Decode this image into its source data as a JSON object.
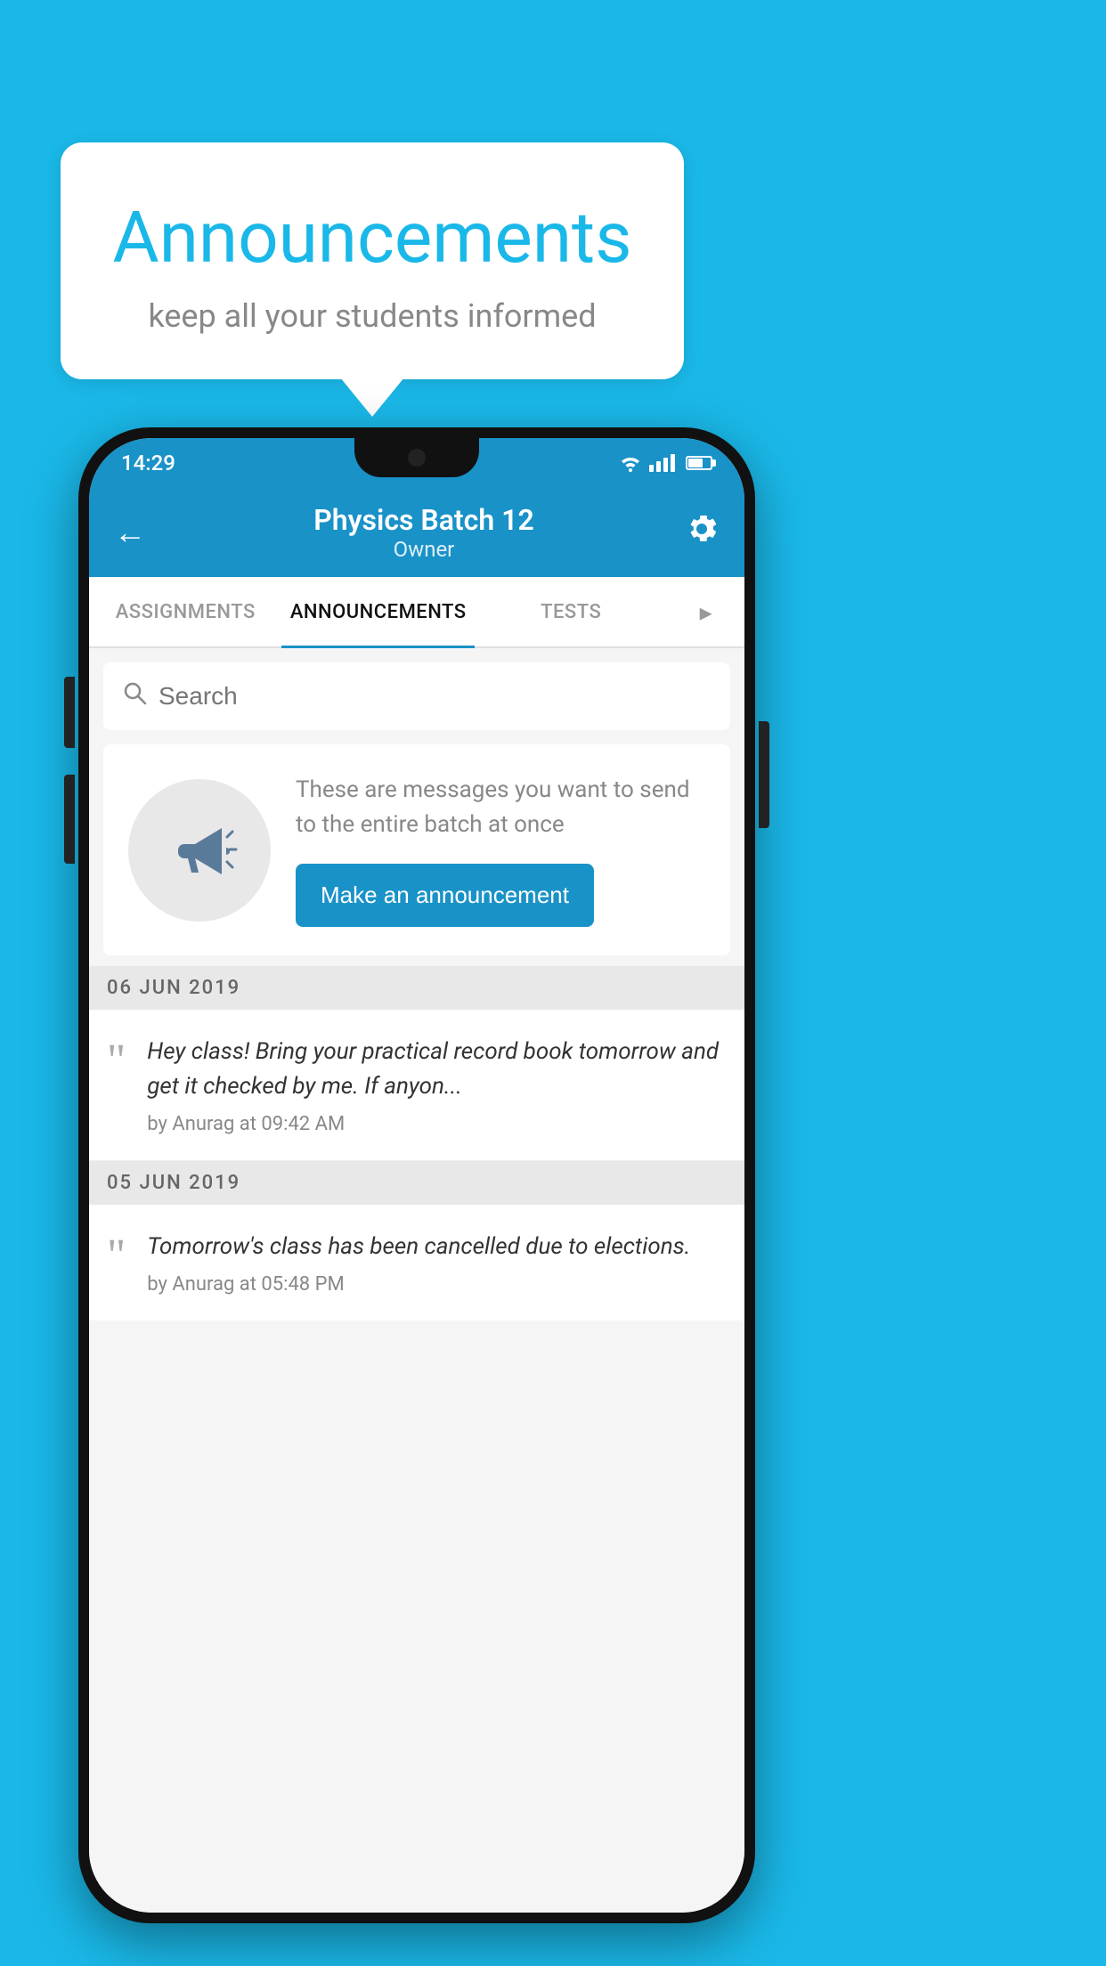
{
  "background_color": "#1ab8e8",
  "speech_bubble": {
    "title": "Announcements",
    "subtitle": "keep all your students informed"
  },
  "status_bar": {
    "time": "14:29",
    "wifi": true,
    "signal": true,
    "battery": true
  },
  "app_bar": {
    "title": "Physics Batch 12",
    "subtitle": "Owner",
    "back_label": "←",
    "gear_label": "⚙"
  },
  "tabs": [
    {
      "label": "ASSIGNMENTS",
      "active": false
    },
    {
      "label": "ANNOUNCEMENTS",
      "active": true
    },
    {
      "label": "TESTS",
      "active": false
    }
  ],
  "search": {
    "placeholder": "Search"
  },
  "empty_state": {
    "description": "These are messages you want to send to the entire batch at once",
    "button_label": "Make an announcement"
  },
  "announcements": [
    {
      "date": "06  JUN  2019",
      "body": "Hey class! Bring your practical record book tomorrow and get it checked by me. If anyon...",
      "meta": "by Anurag at 09:42 AM"
    },
    {
      "date": "05  JUN  2019",
      "body": "Tomorrow's class has been cancelled due to elections.",
      "meta": "by Anurag at 05:48 PM"
    }
  ]
}
